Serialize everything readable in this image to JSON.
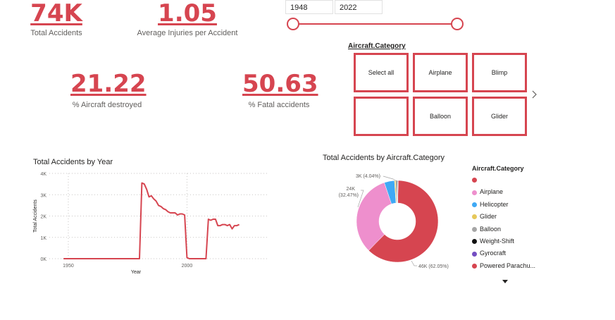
{
  "kpis": {
    "total_accidents": {
      "value": "74K",
      "label": "Total Accidents"
    },
    "avg_injuries": {
      "value": "1.05",
      "label": "Average Injuries per Accident"
    },
    "pct_destroyed": {
      "value": "21.22",
      "label": "% Aircraft destroyed"
    },
    "pct_fatal": {
      "value": "50.63",
      "label": "% Fatal accidents"
    }
  },
  "year_slicer": {
    "start": "1948",
    "end": "2022"
  },
  "category_slicer": {
    "title": "Aircraft.Category",
    "tiles": [
      "Select all",
      "Airplane",
      "Blimp",
      "",
      "Balloon",
      "Glider"
    ],
    "next_icon": "chevron-right-icon"
  },
  "line_chart": {
    "title": "Total Accidents by Year",
    "xlabel": "Year",
    "ylabel": "Total Accidents",
    "y_ticks": [
      "4K",
      "3K",
      "2K",
      "1K",
      "0K"
    ],
    "x_ticks": [
      "1950",
      "2000"
    ],
    "color": "#d64550"
  },
  "donut_chart": {
    "title": "Total Accidents by Aircraft.Category",
    "label_3k": "3K (4.04%)",
    "label_24k_a": "24K",
    "label_24k_b": "(32.47%)",
    "label_46k": "46K (62.05%)"
  },
  "legend": {
    "title": "Aircraft.Category",
    "items": [
      {
        "label": "",
        "color": "#d64550"
      },
      {
        "label": "Airplane",
        "color": "#ee8fcd"
      },
      {
        "label": "Helicopter",
        "color": "#3fa9f5"
      },
      {
        "label": "Glider",
        "color": "#e6c85a"
      },
      {
        "label": "Balloon",
        "color": "#a6a6a6"
      },
      {
        "label": "Weight-Shift",
        "color": "#111111"
      },
      {
        "label": "Gyrocraft",
        "color": "#744ec2"
      },
      {
        "label": "Powered Parachu...",
        "color": "#d64550"
      }
    ],
    "more_icon": "caret-down-icon"
  },
  "chart_data": [
    {
      "type": "line",
      "title": "Total Accidents by Year",
      "xlabel": "Year",
      "ylabel": "Total Accidents",
      "x": [
        1948,
        1960,
        1970,
        1980,
        1981,
        1982,
        1983,
        1984,
        1985,
        1986,
        1987,
        1988,
        1989,
        1990,
        1991,
        1992,
        1993,
        1994,
        1995,
        1996,
        1997,
        1998,
        1999,
        2000,
        2001,
        2005,
        2007,
        2008,
        2009,
        2010,
        2011,
        2012,
        2013,
        2014,
        2015,
        2016,
        2017,
        2018,
        2019,
        2020,
        2021,
        2022
      ],
      "y": [
        0,
        0,
        0,
        0,
        3550,
        3500,
        3250,
        2900,
        2950,
        2800,
        2700,
        2500,
        2450,
        2350,
        2300,
        2200,
        2150,
        2150,
        2150,
        2050,
        2100,
        2100,
        2050,
        50,
        0,
        0,
        0,
        0,
        1850,
        1800,
        1850,
        1850,
        1550,
        1550,
        1600,
        1600,
        1550,
        1600,
        1400,
        1550,
        1550,
        1600
      ],
      "ylim": [
        0,
        4000
      ],
      "xlim": [
        1942,
        2034
      ],
      "grid": true
    },
    {
      "type": "pie",
      "title": "Total Accidents by Aircraft.Category",
      "labels": [
        "",
        "Airplane",
        "Helicopter",
        "Glider",
        "Balloon",
        "Weight-Shift",
        "Gyrocraft",
        "Powered Parachu..."
      ],
      "values": [
        62.05,
        32.47,
        4.04,
        0.5,
        0.4,
        0.3,
        0.2,
        0.04
      ],
      "donut": true
    }
  ]
}
